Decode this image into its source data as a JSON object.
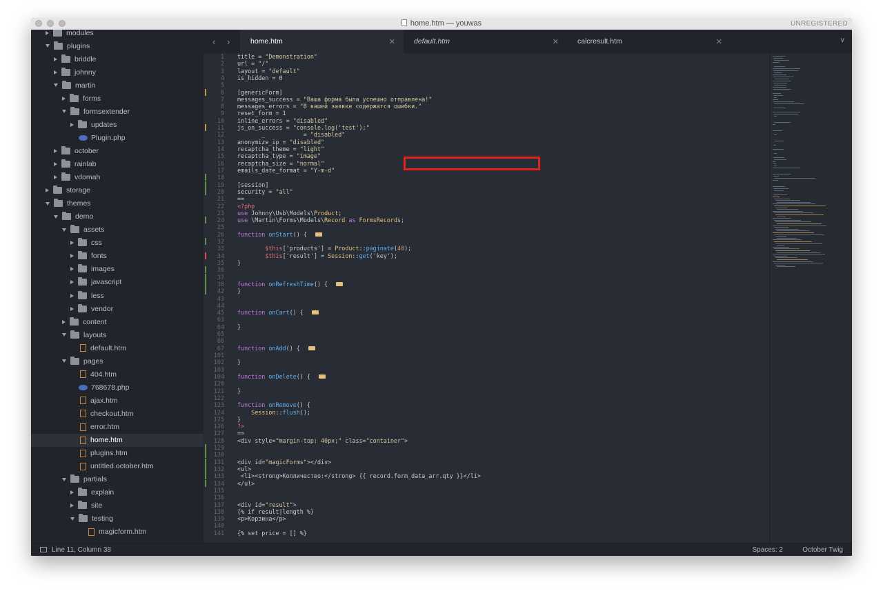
{
  "window": {
    "title": "home.htm — youwas",
    "badge": "UNREGISTERED"
  },
  "sidebar": {
    "items": [
      {
        "label": "modules",
        "level": 1,
        "type": "folder",
        "state": "collapsed"
      },
      {
        "label": "plugins",
        "level": 1,
        "type": "folder",
        "state": "expanded"
      },
      {
        "label": "briddle",
        "level": 2,
        "type": "folder",
        "state": "collapsed"
      },
      {
        "label": "johnny",
        "level": 2,
        "type": "folder",
        "state": "collapsed"
      },
      {
        "label": "martin",
        "level": 2,
        "type": "folder",
        "state": "expanded"
      },
      {
        "label": "forms",
        "level": 3,
        "type": "folder",
        "state": "collapsed"
      },
      {
        "label": "formsextender",
        "level": 3,
        "type": "folder",
        "state": "expanded"
      },
      {
        "label": "updates",
        "level": 4,
        "type": "folder",
        "state": "collapsed"
      },
      {
        "label": "Plugin.php",
        "level": 4,
        "type": "php"
      },
      {
        "label": "october",
        "level": 2,
        "type": "folder",
        "state": "collapsed"
      },
      {
        "label": "rainlab",
        "level": 2,
        "type": "folder",
        "state": "collapsed"
      },
      {
        "label": "vdomah",
        "level": 2,
        "type": "folder",
        "state": "collapsed"
      },
      {
        "label": "storage",
        "level": 1,
        "type": "folder",
        "state": "collapsed"
      },
      {
        "label": "themes",
        "level": 1,
        "type": "folder",
        "state": "expanded"
      },
      {
        "label": "demo",
        "level": 2,
        "type": "folder",
        "state": "expanded"
      },
      {
        "label": "assets",
        "level": 3,
        "type": "folder",
        "state": "expanded"
      },
      {
        "label": "css",
        "level": 4,
        "type": "folder",
        "state": "collapsed"
      },
      {
        "label": "fonts",
        "level": 4,
        "type": "folder",
        "state": "collapsed"
      },
      {
        "label": "images",
        "level": 4,
        "type": "folder",
        "state": "collapsed"
      },
      {
        "label": "javascript",
        "level": 4,
        "type": "folder",
        "state": "collapsed"
      },
      {
        "label": "less",
        "level": 4,
        "type": "folder",
        "state": "collapsed"
      },
      {
        "label": "vendor",
        "level": 4,
        "type": "folder",
        "state": "collapsed"
      },
      {
        "label": "content",
        "level": 3,
        "type": "folder",
        "state": "collapsed"
      },
      {
        "label": "layouts",
        "level": 3,
        "type": "folder",
        "state": "expanded"
      },
      {
        "label": "default.htm",
        "level": 4,
        "type": "file"
      },
      {
        "label": "pages",
        "level": 3,
        "type": "folder",
        "state": "expanded"
      },
      {
        "label": "404.htm",
        "level": 4,
        "type": "file"
      },
      {
        "label": "768678.php",
        "level": 4,
        "type": "php"
      },
      {
        "label": "ajax.htm",
        "level": 4,
        "type": "file"
      },
      {
        "label": "checkout.htm",
        "level": 4,
        "type": "file"
      },
      {
        "label": "error.htm",
        "level": 4,
        "type": "file"
      },
      {
        "label": "home.htm",
        "level": 4,
        "type": "file",
        "selected": true
      },
      {
        "label": "plugins.htm",
        "level": 4,
        "type": "file"
      },
      {
        "label": "untitled.october.htm",
        "level": 4,
        "type": "file"
      },
      {
        "label": "partials",
        "level": 3,
        "type": "folder",
        "state": "expanded"
      },
      {
        "label": "explain",
        "level": 4,
        "type": "folder",
        "state": "collapsed"
      },
      {
        "label": "site",
        "level": 4,
        "type": "folder",
        "state": "collapsed"
      },
      {
        "label": "testing",
        "level": 4,
        "type": "folder",
        "state": "expanded"
      },
      {
        "label": "magicform.htm",
        "level": 5,
        "type": "file"
      }
    ]
  },
  "tabs": [
    {
      "label": "home.htm",
      "active": true,
      "italic": false
    },
    {
      "label": "default.htm",
      "active": false,
      "italic": true
    },
    {
      "label": "calcresult.htm",
      "active": false,
      "italic": false
    }
  ],
  "editor": {
    "lines": [
      {
        "n": "1",
        "t": "title = \"Demonstration\""
      },
      {
        "n": "2",
        "t": "url = \"/\""
      },
      {
        "n": "3",
        "t": "layout = \"default\""
      },
      {
        "n": "4",
        "t": "is_hidden = 0"
      },
      {
        "n": "5",
        "t": ""
      },
      {
        "n": "6",
        "t": "[genericForm]",
        "g": "orange"
      },
      {
        "n": "7",
        "t": "messages_success = \"Ваша форма была успешно отправлена!\""
      },
      {
        "n": "8",
        "t": "messages_errors = \"В вашей заявке содержатся ошибки.\""
      },
      {
        "n": "9",
        "t": "reset_form = 1"
      },
      {
        "n": "10",
        "t": "inline_errors = \"disabled\""
      },
      {
        "n": "11",
        "t": "js_on_success = \"console.log('test');\"",
        "g": "orange"
      },
      {
        "n": "12",
        "t": "       _           = \"disabled\""
      },
      {
        "n": "13",
        "t": "anonymize_ip = \"disabled\""
      },
      {
        "n": "14",
        "t": "recaptcha_theme = \"light\""
      },
      {
        "n": "15",
        "t": "recaptcha_type = \"image\""
      },
      {
        "n": "16",
        "t": "recaptcha_size = \"normal\""
      },
      {
        "n": "17",
        "t": "emails_date_format = \"Y-m-d\""
      },
      {
        "n": "18",
        "t": "",
        "g": "green"
      },
      {
        "n": "19",
        "t": "[session]",
        "g": "green"
      },
      {
        "n": "20",
        "t": "security = \"all\"",
        "g": "green"
      },
      {
        "n": "21",
        "t": "=="
      },
      {
        "n": "22",
        "t": "<?php",
        "c": "v"
      },
      {
        "n": "23",
        "t": "use Johnny\\Usb\\Models\\Product;"
      },
      {
        "n": "24",
        "t": "use \\Martin\\Forms\\Models\\Record as FormsRecords;",
        "g": "green"
      },
      {
        "n": "25",
        "t": ""
      },
      {
        "n": "26",
        "t": "function onStart() {  ",
        "fold": true,
        "fn": "onStart"
      },
      {
        "n": "32",
        "t": "",
        "g": "green"
      },
      {
        "n": "33",
        "t": "        $this['products'] = Product::paginate(40);"
      },
      {
        "n": "34",
        "t": "        $this['result'] = Session::get('key');",
        "g": "red"
      },
      {
        "n": "35",
        "t": "}"
      },
      {
        "n": "36",
        "t": "",
        "g": "green"
      },
      {
        "n": "37",
        "t": "",
        "g": "green"
      },
      {
        "n": "38",
        "t": "function onRefreshTime() {  ",
        "fold": true,
        "fn": "onRefreshTime",
        "g": "green"
      },
      {
        "n": "42",
        "t": "}",
        "g": "green"
      },
      {
        "n": "43",
        "t": ""
      },
      {
        "n": "44",
        "t": ""
      },
      {
        "n": "45",
        "t": "function onCart() {  ",
        "fold": true,
        "fn": "onCart"
      },
      {
        "n": "63",
        "t": ""
      },
      {
        "n": "64",
        "t": "}"
      },
      {
        "n": "65",
        "t": ""
      },
      {
        "n": "66",
        "t": ""
      },
      {
        "n": "67",
        "t": "function onAdd() {  ",
        "fold": true,
        "fn": "onAdd"
      },
      {
        "n": "101",
        "t": ""
      },
      {
        "n": "102",
        "t": "}"
      },
      {
        "n": "103",
        "t": ""
      },
      {
        "n": "104",
        "t": "function onDelete() {  ",
        "fold": true,
        "fn": "onDelete"
      },
      {
        "n": "120",
        "t": ""
      },
      {
        "n": "121",
        "t": "}"
      },
      {
        "n": "122",
        "t": ""
      },
      {
        "n": "123",
        "t": "function onRemove() {",
        "fn": "onRemove"
      },
      {
        "n": "124",
        "t": "    Session::flush();"
      },
      {
        "n": "125",
        "t": "}"
      },
      {
        "n": "126",
        "t": "?>",
        "c": "v"
      },
      {
        "n": "127",
        "t": "=="
      },
      {
        "n": "128",
        "t": "<div style=\"margin-top: 40px;\" class=\"container\">"
      },
      {
        "n": "129",
        "t": "",
        "g": "green"
      },
      {
        "n": "130",
        "t": "",
        "g": "green"
      },
      {
        "n": "131",
        "t": "<div id=\"magicForms\"></div>",
        "g": "green"
      },
      {
        "n": "132",
        "t": "<ul>",
        "g": "green"
      },
      {
        "n": "133",
        "t": " <li><strong>Колличество:</strong> {{ record.form_data_arr.qty }}</li>",
        "g": "green"
      },
      {
        "n": "134",
        "t": "</ul>",
        "g": "green"
      },
      {
        "n": "135",
        "t": ""
      },
      {
        "n": "136",
        "t": ""
      },
      {
        "n": "137",
        "t": "<div id=\"result\">"
      },
      {
        "n": "138",
        "t": "{% if result|length %}"
      },
      {
        "n": "139",
        "t": "<p>Корзина</p>"
      },
      {
        "n": "140",
        "t": ""
      },
      {
        "n": "141",
        "t": "{% set price = [] %}"
      }
    ]
  },
  "status": {
    "position": "Line 11, Column 38",
    "spaces": "Spaces: 2",
    "syntax": "October Twig"
  },
  "colors": {
    "gutter_green": "#5f8e4a",
    "gutter_orange": "#c9954c",
    "gutter_red": "#e0484f",
    "highlight": "#e2231a"
  }
}
